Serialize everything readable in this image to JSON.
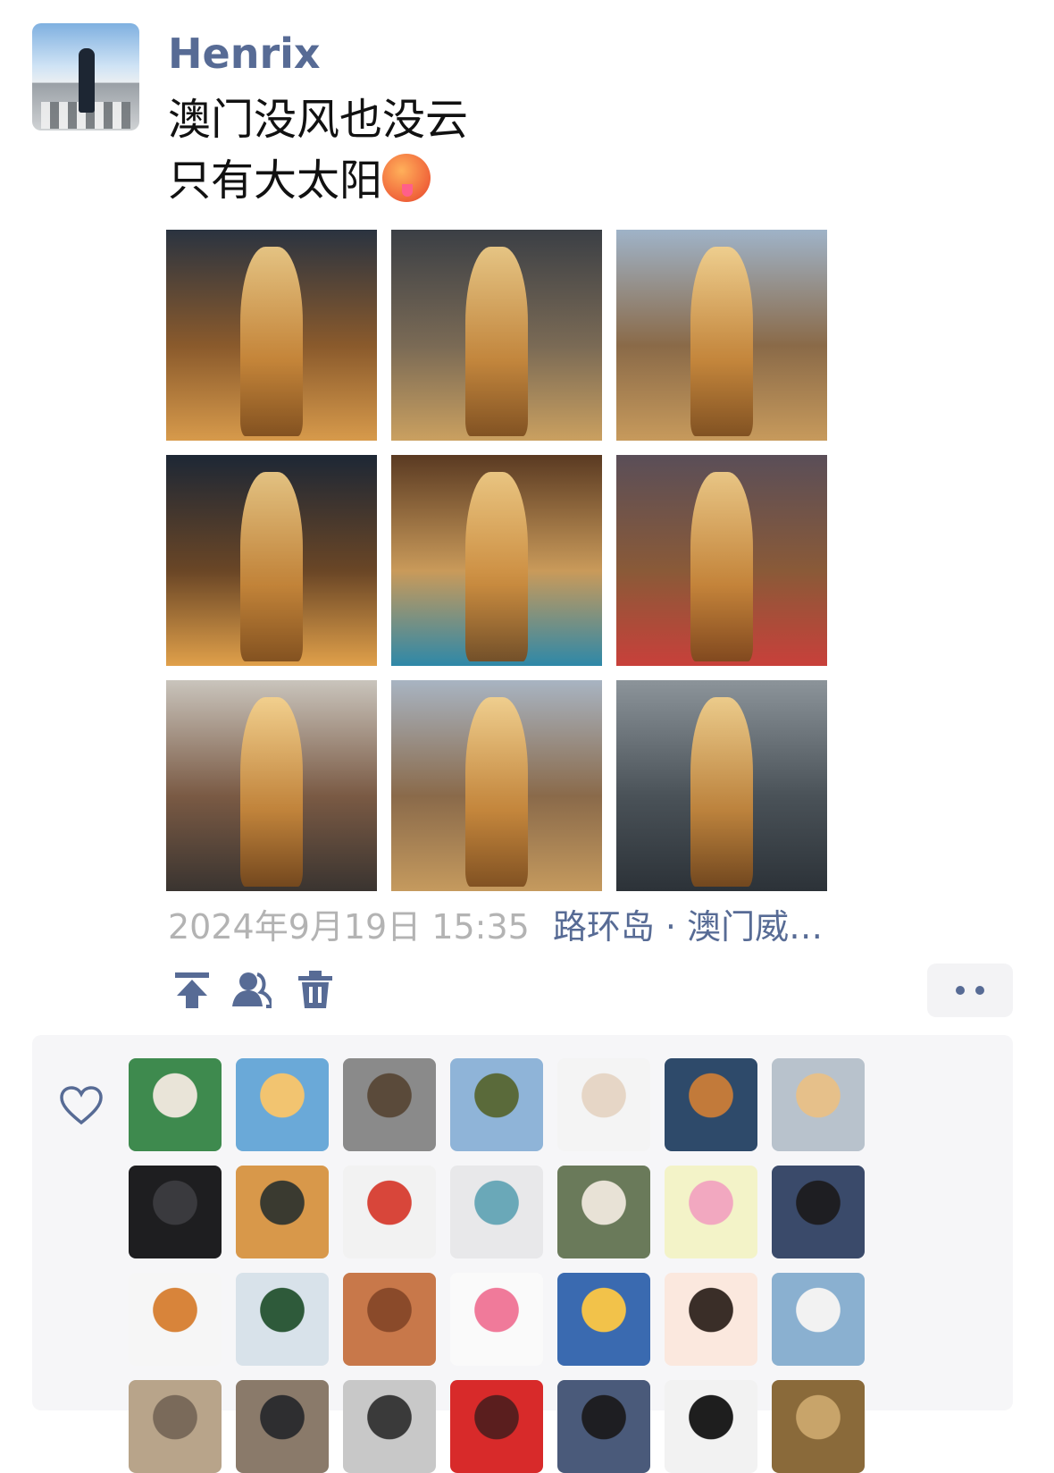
{
  "post": {
    "author": "Henrix",
    "text_line1": "澳门没风也没云",
    "text_line2": "只有大太阳",
    "emoji": "hot-face-emoji",
    "date": "2024年9月19日 15:35",
    "location": "路环岛 · 澳门威…"
  },
  "photos": [
    {
      "name": "photo-aerial-lisboa-tower",
      "colors": [
        "#2a3340",
        "#8a5a2c",
        "#d79a4b"
      ]
    },
    {
      "name": "photo-street-lisboa-tower",
      "colors": [
        "#3b3f45",
        "#7a6a55",
        "#caa060"
      ]
    },
    {
      "name": "photo-skyline-lisboa-tower",
      "colors": [
        "#9fb3c8",
        "#8a6a48",
        "#c79a5c"
      ]
    },
    {
      "name": "photo-clocktower-night",
      "colors": [
        "#1d2735",
        "#6a4626",
        "#e0a04a"
      ]
    },
    {
      "name": "photo-dome-ceiling",
      "colors": [
        "#5a3a22",
        "#c99a5a",
        "#2e88a8"
      ]
    },
    {
      "name": "photo-red-bus-palace",
      "colors": [
        "#5a4e58",
        "#8a5a38",
        "#c8403a"
      ]
    },
    {
      "name": "photo-ruins-statues",
      "colors": [
        "#c9c4bc",
        "#7a5a44",
        "#3a3430"
      ]
    },
    {
      "name": "photo-tower-harbor",
      "colors": [
        "#a8b4c2",
        "#8a6a4a",
        "#c59a5e"
      ]
    },
    {
      "name": "photo-modern-skyline",
      "colors": [
        "#8c949a",
        "#4a5258",
        "#2c3238"
      ]
    }
  ],
  "actions": {
    "pin_icon": "pin-to-top-icon",
    "visibility_icon": "visibility-icon",
    "delete_icon": "trash-icon",
    "more_icon": "more-dots-icon"
  },
  "likes": {
    "icon": "heart-icon",
    "users": [
      {
        "name": "liker-1",
        "colors": [
          "#3e8a4e",
          "#e9e4d8"
        ]
      },
      {
        "name": "liker-2",
        "colors": [
          "#6aa9d8",
          "#f2c470"
        ]
      },
      {
        "name": "liker-3",
        "colors": [
          "#8a8a8a",
          "#5a4a3a"
        ]
      },
      {
        "name": "liker-4",
        "colors": [
          "#8fb4d8",
          "#5a6a3a"
        ]
      },
      {
        "name": "liker-5",
        "colors": [
          "#f4f4f4",
          "#e6d6c6"
        ]
      },
      {
        "name": "liker-6",
        "colors": [
          "#2e4a6a",
          "#c27a3a"
        ]
      },
      {
        "name": "liker-7",
        "colors": [
          "#b8c2cc",
          "#e6c08a"
        ]
      },
      {
        "name": "liker-8",
        "colors": [
          "#1e1e20",
          "#3a3a3e"
        ]
      },
      {
        "name": "liker-9",
        "colors": [
          "#d8984a",
          "#3a3a30"
        ]
      },
      {
        "name": "liker-10",
        "colors": [
          "#f2f2f2",
          "#d8463a"
        ]
      },
      {
        "name": "liker-11",
        "colors": [
          "#e8e8ea",
          "#6aa8b8"
        ]
      },
      {
        "name": "liker-12",
        "colors": [
          "#6a7a5a",
          "#e8e2d6"
        ]
      },
      {
        "name": "liker-13",
        "colors": [
          "#f3f3c8",
          "#f2a8c0"
        ]
      },
      {
        "name": "liker-14",
        "colors": [
          "#3a4a6a",
          "#1e1e22"
        ]
      },
      {
        "name": "liker-15",
        "colors": [
          "#f6f6f6",
          "#d8843a"
        ]
      },
      {
        "name": "liker-16",
        "colors": [
          "#d8e2ea",
          "#2e5a3a"
        ]
      },
      {
        "name": "liker-17",
        "colors": [
          "#c8784a",
          "#8a4a2a"
        ]
      },
      {
        "name": "liker-18",
        "colors": [
          "#fafafa",
          "#f07a9a"
        ]
      },
      {
        "name": "liker-19",
        "colors": [
          "#3a6ab0",
          "#f2c24a"
        ]
      },
      {
        "name": "liker-20",
        "colors": [
          "#fbe8de",
          "#3a2e28"
        ]
      },
      {
        "name": "liker-21",
        "colors": [
          "#8ab0d0",
          "#f2f2f2"
        ]
      },
      {
        "name": "liker-22",
        "colors": [
          "#b8a48a",
          "#7a6a5a"
        ]
      },
      {
        "name": "liker-23",
        "colors": [
          "#8a7a6a",
          "#2e2e30"
        ]
      },
      {
        "name": "liker-24",
        "colors": [
          "#c8c8c8",
          "#3a3a3a"
        ]
      },
      {
        "name": "liker-25",
        "colors": [
          "#d82a2a",
          "#5a1e1e"
        ]
      },
      {
        "name": "liker-26",
        "colors": [
          "#4a5a7a",
          "#1e1e22"
        ]
      },
      {
        "name": "liker-27",
        "colors": [
          "#f2f2f2",
          "#1e1e1e"
        ]
      },
      {
        "name": "liker-28",
        "colors": [
          "#8a6a3a",
          "#c8a46a"
        ]
      }
    ]
  }
}
